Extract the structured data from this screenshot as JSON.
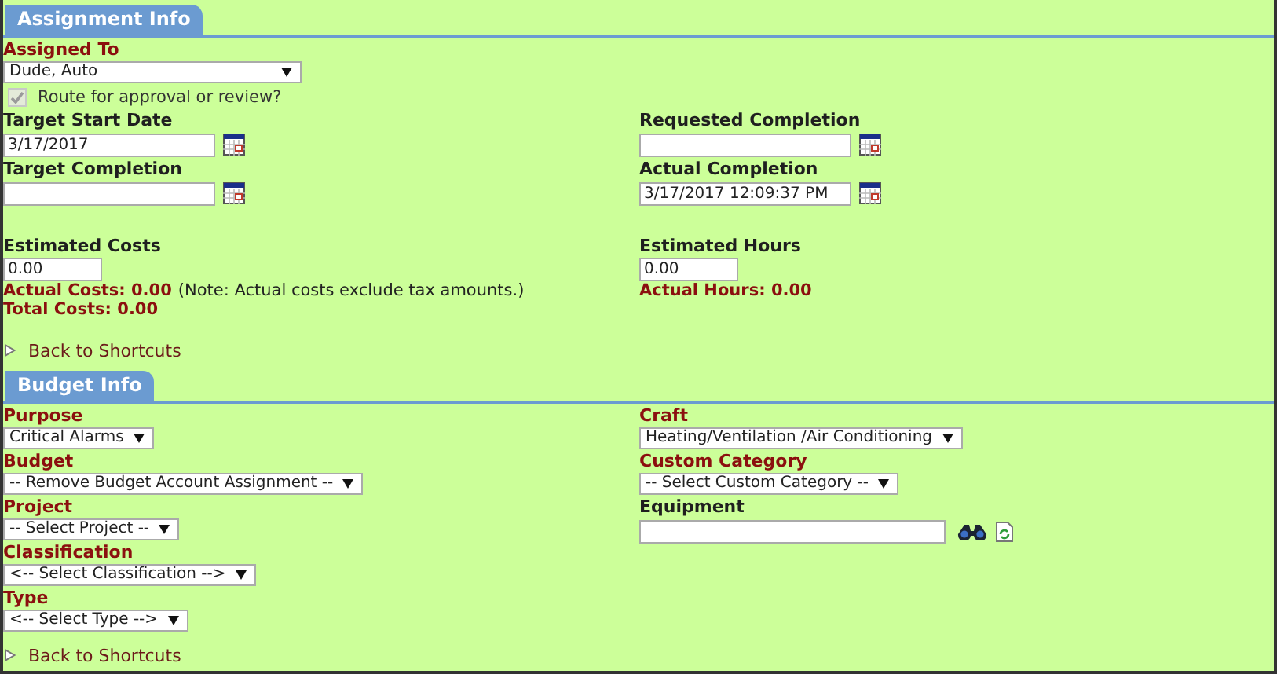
{
  "assignment_info": {
    "title": "Assignment Info",
    "assigned_to": {
      "label": "Assigned To",
      "required": true,
      "value": "Dude, Auto"
    },
    "route": {
      "label": "Route for approval or review?",
      "checked": true,
      "disabled": true
    },
    "dates": [
      {
        "label": "Target Start Date",
        "required": false,
        "value": "3/17/2017"
      },
      {
        "label": "Requested Completion",
        "required": false
      },
      {
        "label": "Target Completion",
        "required": false
      },
      {
        "label": "Actual Completion",
        "required": false,
        "value": "3/17/2017 12:09:37 PM"
      }
    ],
    "estimates": [
      {
        "label": "Estimated Costs",
        "required": false,
        "value": "0.00",
        "lines": [
          {
            "text": "Actual Costs: 0.00",
            "note": "(Note: Actual costs exclude tax amounts.)"
          },
          {
            "text": "Total Costs: 0.00"
          }
        ]
      },
      {
        "label": "Estimated Hours",
        "required": false,
        "value": "0.00",
        "lines": [
          {
            "text": "Actual Hours: 0.00"
          }
        ]
      }
    ],
    "back_link": "Back to Shortcuts"
  },
  "budget_info": {
    "title": "Budget Info",
    "left": [
      {
        "label": "Purpose",
        "required": true,
        "kind": "select",
        "value": "Critical Alarms"
      },
      {
        "label": "Budget",
        "required": true,
        "kind": "select",
        "value": "-- Remove Budget Account Assignment --"
      },
      {
        "label": "Project",
        "required": true,
        "kind": "select",
        "value": "-- Select Project --"
      },
      {
        "label": "Classification",
        "required": true,
        "kind": "select",
        "value": "<-- Select Classification -->"
      },
      {
        "label": "Type",
        "required": true,
        "kind": "select",
        "value": "<-- Select Type -->"
      }
    ],
    "right": [
      {
        "label": "Craft",
        "required": true,
        "kind": "select",
        "value": "Heating/Ventilation /Air Conditioning"
      },
      {
        "label": "Custom Category",
        "required": true,
        "kind": "select",
        "value": "-- Select Custom Category --"
      },
      {
        "label": "Equipment",
        "required": false,
        "kind": "lookup"
      }
    ],
    "back_link": "Back to Shortcuts"
  }
}
